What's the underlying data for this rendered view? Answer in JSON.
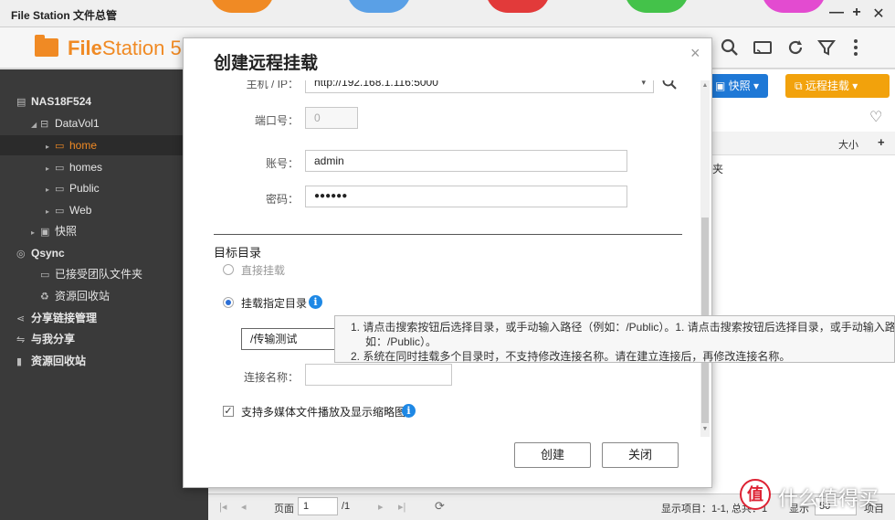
{
  "window": {
    "title": "File Station 文件总管",
    "minimize": "—",
    "maximize": "+",
    "close": "✕"
  },
  "app": {
    "logo_bold": "File",
    "logo_rest": "Station 5"
  },
  "header_icons": [
    "search-icon",
    "cast-icon",
    "refresh-icon",
    "filter-icon",
    "more-icon"
  ],
  "sidebar": {
    "items": [
      {
        "label": "NAS18F524",
        "icon": "server-icon"
      },
      {
        "label": "DataVol1",
        "icon": "disk-icon"
      },
      {
        "label": "home",
        "icon": "folder-icon"
      },
      {
        "label": "homes",
        "icon": "folder-icon"
      },
      {
        "label": "Public",
        "icon": "folder-icon"
      },
      {
        "label": "Web",
        "icon": "folder-icon"
      },
      {
        "label": "快照",
        "icon": "snapshot-icon"
      },
      {
        "label": "Qsync",
        "icon": "qsync-icon"
      },
      {
        "label": "已接受团队文件夹",
        "icon": "team-folder-icon"
      },
      {
        "label": "资源回收站",
        "icon": "recycle-icon"
      },
      {
        "label": "分享链接管理",
        "icon": "share-icon"
      },
      {
        "label": "与我分享",
        "icon": "shared-with-me-icon"
      },
      {
        "label": "资源回收站",
        "icon": "trash-icon"
      }
    ]
  },
  "main": {
    "snapshot_button": "快照",
    "remote_mount_button": "远程挂载",
    "col_size": "大小",
    "col_add": "+",
    "partial_text": "夹",
    "status": {
      "page_label": "页面",
      "page_value": "1",
      "page_total": "/1",
      "display_items": "显示项目：1-1, 总共：1",
      "show_label": "显示",
      "show_value": "50",
      "items_label": "项目"
    }
  },
  "dialog": {
    "title": "创建远程挂载",
    "close": "×",
    "host_label": "主机 / IP：",
    "host_value": "http://192.168.1.116:5000",
    "port_label": "端口号：",
    "port_value": "0",
    "account_label": "账号：",
    "account_value": "admin",
    "password_label": "密码：",
    "password_value": "●●●●●●",
    "target_section": "目标目录",
    "option_direct": "直接挂载",
    "option_specified": "挂载指定目录",
    "path_value": "/传输测试",
    "conn_name_label": "连接名称：",
    "conn_name_value": "",
    "media_checkbox_label": "支持多媒体文件播放及显示缩略图",
    "create_button": "创建",
    "close_button": "关闭"
  },
  "tooltip": {
    "line1": "1. 请点击搜索按钮后选择目录，或手动输入路径（例如：/Public）。1. 请点击搜索按钮后选择目录，或手动输入路径（例",
    "line2": "如：/Public）。",
    "line3": "2. 系统在同时挂载多个目录时，不支持修改连接名称。请在建立连接后，再修改连接名称。"
  },
  "watermark": {
    "badge": "值",
    "text": "什么值得买"
  },
  "colors": {
    "accent": "#f08a24",
    "snapshot_btn": "#1e78d6",
    "remote_btn": "#f2a20c",
    "info": "#1e88e5",
    "sidebar_bg": "#3a3a3a"
  }
}
